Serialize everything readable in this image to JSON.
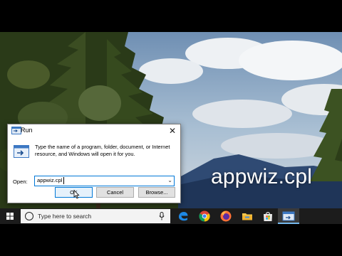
{
  "overlay": {
    "caption": "appwiz.cpl"
  },
  "run_dialog": {
    "title": "Run",
    "close_glyph": "✕",
    "description": "Type the name of a program, folder, document, or Internet resource, and Windows will open it for you.",
    "open_label": "Open:",
    "open_value": "appwiz.cpl",
    "buttons": {
      "ok": "OK",
      "cancel": "Cancel",
      "browse": "Browse..."
    }
  },
  "taskbar": {
    "search_placeholder": "Type here to search",
    "pinned_icons": [
      "edge-icon",
      "chrome-icon",
      "firefox-icon",
      "file-explorer-icon",
      "store-icon",
      "run-icon"
    ]
  },
  "colors": {
    "accent": "#0078d7",
    "taskbar": "#1c1c1c"
  }
}
